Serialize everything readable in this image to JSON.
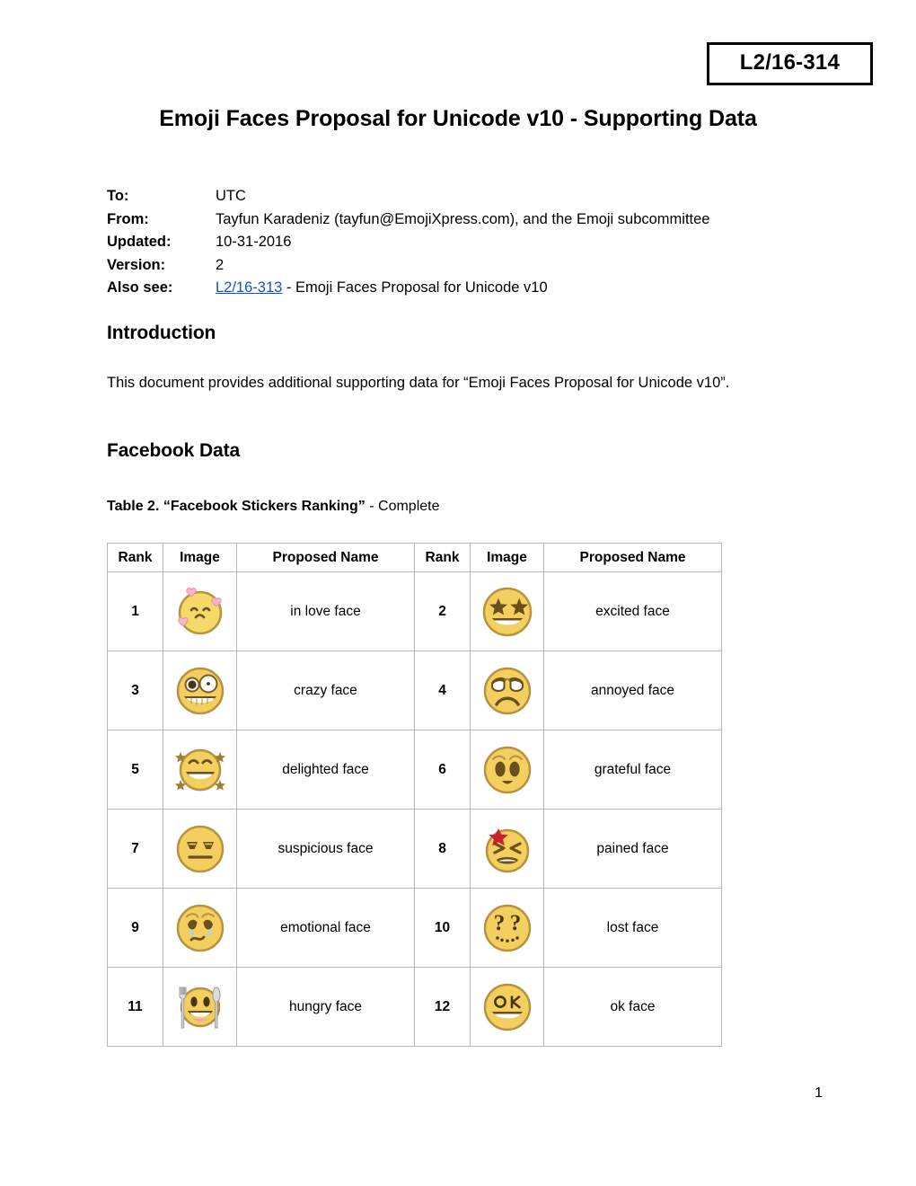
{
  "document": {
    "number_box": "L2/16-314",
    "title": "Emoji Faces Proposal for Unicode v10 - Supporting Data",
    "page_number": "1"
  },
  "meta": {
    "rows": [
      {
        "label": "To:",
        "value": "UTC"
      },
      {
        "label": "From:",
        "value": "Tayfun Karadeniz (tayfun@EmojiXpress.com), and the Emoji subcommittee"
      },
      {
        "label": "Updated:",
        "value": "10-31-2016"
      },
      {
        "label": "Version:",
        "value": "2"
      }
    ],
    "also_see": {
      "label": "Also see:",
      "link_text": "L2/16-313",
      "link_color": "#1155cc",
      "suffix": " - Emoji Faces Proposal for Unicode v10"
    }
  },
  "sections": {
    "introduction_heading": "Introduction",
    "introduction_body": "This document provides additional supporting data for “Emoji Faces Proposal for Unicode v10”.",
    "facebook_heading": "Facebook Data"
  },
  "table": {
    "caption_bold": "Table 2. “Facebook Stickers Ranking”",
    "caption_rest": " - Complete",
    "headers": [
      "Rank",
      "Image",
      "Proposed Name",
      "Rank",
      "Image",
      "Proposed Name"
    ],
    "rows": [
      {
        "left": {
          "rank": "1",
          "icon": "in-love-face-emoji",
          "name": "in love face"
        },
        "right": {
          "rank": "2",
          "icon": "excited-face-emoji",
          "name": "excited face"
        }
      },
      {
        "left": {
          "rank": "3",
          "icon": "crazy-face-emoji",
          "name": "crazy face"
        },
        "right": {
          "rank": "4",
          "icon": "annoyed-face-emoji",
          "name": "annoyed face"
        }
      },
      {
        "left": {
          "rank": "5",
          "icon": "delighted-face-emoji",
          "name": "delighted face"
        },
        "right": {
          "rank": "6",
          "icon": "grateful-face-emoji",
          "name": "grateful face"
        }
      },
      {
        "left": {
          "rank": "7",
          "icon": "suspicious-face-emoji",
          "name": "suspicious face"
        },
        "right": {
          "rank": "8",
          "icon": "pained-face-emoji",
          "name": "pained face"
        }
      },
      {
        "left": {
          "rank": "9",
          "icon": "emotional-face-emoji",
          "name": "emotional face"
        },
        "right": {
          "rank": "10",
          "icon": "lost-face-emoji",
          "name": "lost face"
        }
      },
      {
        "left": {
          "rank": "11",
          "icon": "hungry-face-emoji",
          "name": "hungry face"
        },
        "right": {
          "rank": "12",
          "icon": "ok-face-emoji",
          "name": "ok face"
        }
      }
    ]
  },
  "colors": {
    "face_fill": "#f5da6a",
    "face_rim": "#b79340",
    "heart_pink": "#f9b5c4",
    "star_brown": "#8a6a2f",
    "star_red": "#cc2030",
    "table_border": "#b7b7b7",
    "link": "#1155cc"
  }
}
